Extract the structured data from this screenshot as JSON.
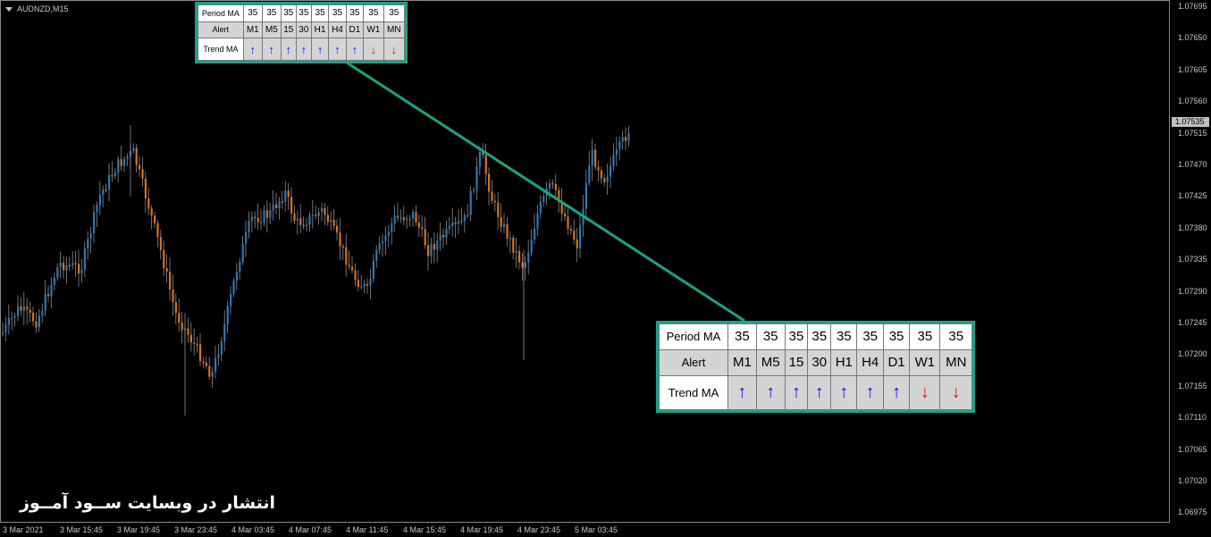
{
  "symbol": "AUDNZD,M15",
  "price_axis": [
    "1.07695",
    "1.07650",
    "1.07605",
    "1.07560",
    "1.07515",
    "1.07470",
    "1.07425",
    "1.07380",
    "1.07335",
    "1.07290",
    "1.07245",
    "1.07200",
    "1.07155",
    "1.07110",
    "1.07065",
    "1.07020",
    "1.06975"
  ],
  "current_price": "1.07535",
  "time_axis": [
    "3 Mar 2021",
    "3 Mar 15:45",
    "3 Mar 19:45",
    "3 Mar 23:45",
    "4 Mar 03:45",
    "4 Mar 07:45",
    "4 Mar 11:45",
    "4 Mar 15:45",
    "4 Mar 19:45",
    "4 Mar 23:45",
    "5 Mar 03:45"
  ],
  "colors": {
    "bull": "#2b78b8",
    "bear": "#d8721e",
    "panel_border": "#1aa38a",
    "up_arrow": "#1010ee",
    "down_arrow": "#ee1010"
  },
  "ma_panel": {
    "period_label": "Period MA",
    "periods": [
      "35",
      "35",
      "35",
      "35",
      "35",
      "35",
      "35",
      "35",
      "35"
    ],
    "alert_label": "Alert",
    "timeframes": [
      "M1",
      "M5",
      "15",
      "30",
      "H1",
      "H4",
      "D1",
      "W1",
      "MN"
    ],
    "trend_label": "Trend MA",
    "trends": [
      {
        "dir": "up",
        "icon": "arrow-up-icon"
      },
      {
        "dir": "up",
        "icon": "arrow-up-icon"
      },
      {
        "dir": "up",
        "icon": "arrow-up-icon"
      },
      {
        "dir": "up",
        "icon": "arrow-up-icon"
      },
      {
        "dir": "up",
        "icon": "arrow-up-icon"
      },
      {
        "dir": "up",
        "icon": "arrow-up-icon"
      },
      {
        "dir": "up",
        "icon": "arrow-up-icon"
      },
      {
        "dir": "down",
        "icon": "arrow-down-icon"
      },
      {
        "dir": "down",
        "icon": "arrow-down-icon"
      }
    ]
  },
  "watermark": "انتشار در وبسایت ســود آمــوز"
}
